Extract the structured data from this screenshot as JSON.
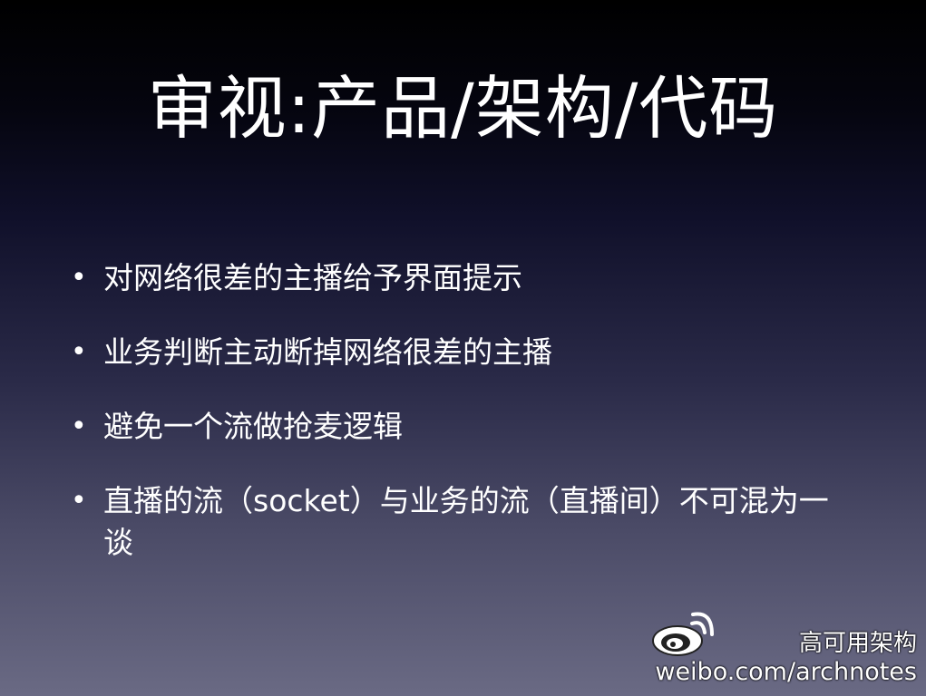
{
  "slide": {
    "title": "审视:产品/架构/代码",
    "bullet_glyph": "•",
    "bullets": [
      {
        "text": "对网络很差的主播给予界面提示"
      },
      {
        "text": "业务判断主动断掉网络很差的主播"
      },
      {
        "text": "避免一个流做抢麦逻辑"
      },
      {
        "text": "直播的流（socket）与业务的流（直播间）不可混为一谈"
      }
    ]
  },
  "watermark": {
    "logo_icon": "weibo-logo-icon",
    "name": "高可用架构",
    "url": "weibo.com/archnotes"
  }
}
